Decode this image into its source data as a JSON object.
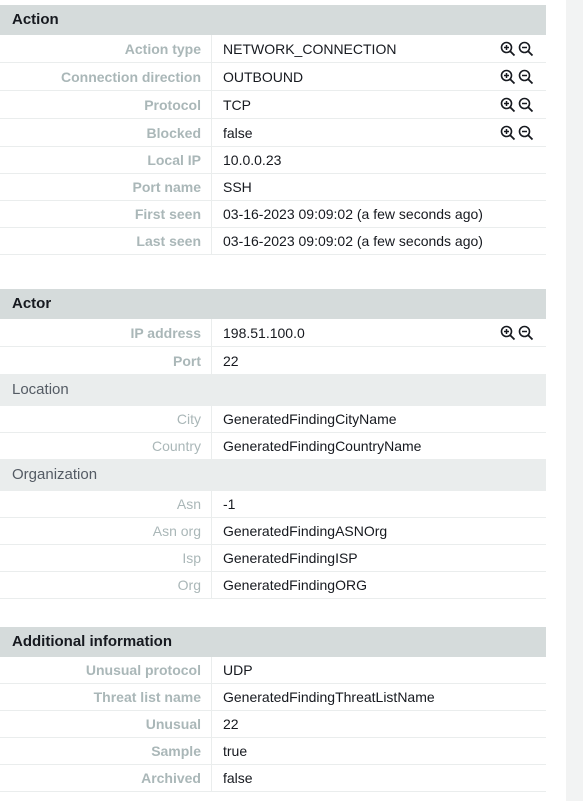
{
  "action": {
    "title": "Action",
    "rows": [
      {
        "label": "Action type",
        "value": "NETWORK_CONNECTION"
      },
      {
        "label": "Connection direction",
        "value": "OUTBOUND"
      },
      {
        "label": "Protocol",
        "value": "TCP"
      },
      {
        "label": "Blocked",
        "value": "false"
      },
      {
        "label": "Local IP",
        "value": "10.0.0.23"
      },
      {
        "label": "Port name",
        "value": "SSH"
      },
      {
        "label": "First seen",
        "value": "03-16-2023 09:09:02 (a few seconds ago)"
      },
      {
        "label": "Last seen",
        "value": "03-16-2023 09:09:02 (a few seconds ago)"
      }
    ]
  },
  "actor": {
    "title": "Actor",
    "rows": [
      {
        "label": "IP address",
        "value": "198.51.100.0"
      },
      {
        "label": "Port",
        "value": "22"
      }
    ],
    "location": {
      "title": "Location",
      "rows": [
        {
          "label": "City",
          "value": "GeneratedFindingCityName"
        },
        {
          "label": "Country",
          "value": "GeneratedFindingCountryName"
        }
      ]
    },
    "organization": {
      "title": "Organization",
      "rows": [
        {
          "label": "Asn",
          "value": "-1"
        },
        {
          "label": "Asn org",
          "value": "GeneratedFindingASNOrg"
        },
        {
          "label": "Isp",
          "value": "GeneratedFindingISP"
        },
        {
          "label": "Org",
          "value": "GeneratedFindingORG"
        }
      ]
    }
  },
  "additional": {
    "title": "Additional information",
    "rows": [
      {
        "label": "Unusual protocol",
        "value": "UDP"
      },
      {
        "label": "Threat list name",
        "value": "GeneratedFindingThreatListName"
      },
      {
        "label": "Unusual",
        "value": "22"
      },
      {
        "label": "Sample",
        "value": "true"
      },
      {
        "label": "Archived",
        "value": "false"
      }
    ]
  },
  "icons": {
    "zoom_in": "zoom-in-icon",
    "zoom_out": "zoom-out-icon"
  },
  "colors": {
    "header_bg": "#d5dbdb",
    "subheader_bg": "#eaeded",
    "label": "#aab7b8"
  }
}
